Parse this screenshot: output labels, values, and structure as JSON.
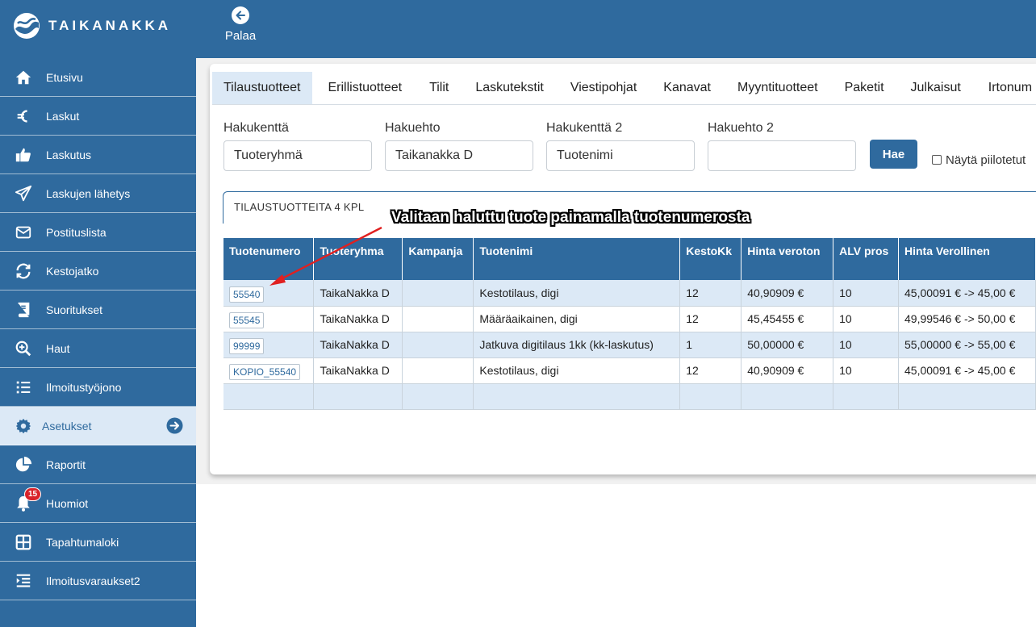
{
  "brand": {
    "name": "TAIKANAKKA",
    "logo_icon": "wave-logo-icon"
  },
  "header": {
    "back_label": "Palaa",
    "back_icon": "arrow-left-circle-icon"
  },
  "sidebar": {
    "items": [
      {
        "label": "Etusivu",
        "icon": "home-icon"
      },
      {
        "label": "Laskut",
        "icon": "euro-icon"
      },
      {
        "label": "Laskutus",
        "icon": "thumbs-up-icon"
      },
      {
        "label": "Laskujen lähetys",
        "icon": "paper-plane-icon"
      },
      {
        "label": "Postituslista",
        "icon": "envelope-icon"
      },
      {
        "label": "Kestojatko",
        "icon": "sync-icon"
      },
      {
        "label": "Suoritukset",
        "icon": "book-icon"
      },
      {
        "label": "Haut",
        "icon": "search-plus-icon"
      },
      {
        "label": "Ilmoitustyöjono",
        "icon": "list-icon"
      },
      {
        "label": "Asetukset",
        "icon": "gear-icon"
      },
      {
        "label": "Raportit",
        "icon": "pie-chart-icon"
      },
      {
        "label": "Huomiot",
        "icon": "bell-icon",
        "badge": "15"
      },
      {
        "label": "Tapahtumaloki",
        "icon": "grid-icon"
      },
      {
        "label": "Ilmoitusvaraukset2",
        "icon": "indent-list-icon"
      }
    ]
  },
  "tabs": [
    "Tilaustuotteet",
    "Erillistuotteet",
    "Tilit",
    "Laskutekstit",
    "Viestipohjat",
    "Kanavat",
    "Myyntituotteet",
    "Paketit",
    "Julkaisut",
    "Irtonum"
  ],
  "search": {
    "field1_label": "Hakukenttä",
    "field1_value": "Tuoteryhmä",
    "cond1_label": "Hakuehto",
    "cond1_value": "Taikanakka D",
    "field2_label": "Hakukenttä 2",
    "field2_value": "Tuotenimi",
    "cond2_label": "Hakuehto 2",
    "cond2_value": "",
    "button_label": "Hae",
    "show_hidden_label": "Näytä piilotetut"
  },
  "section_title": "TILAUSTUOTTEITA 4 KPL",
  "annotation": "Valitaan haluttu tuote painamalla tuotenumerosta",
  "table": {
    "columns": [
      "Tuotenumero",
      "Tuoteryhma",
      "Kampanja",
      "Tuotenimi",
      "KestoKk",
      "Hinta veroton",
      "ALV pros",
      "Hinta Verollinen"
    ],
    "rows": [
      [
        "55540",
        "TaikaNakka D",
        "",
        "Kestotilaus, digi",
        "12",
        "40,90909 €",
        "10",
        "45,00091 € -> 45,00 €"
      ],
      [
        "55545",
        "TaikaNakka D",
        "",
        "Määräaikainen, digi",
        "12",
        "45,45455 €",
        "10",
        "49,99546 € -> 50,00 €"
      ],
      [
        "99999",
        "TaikaNakka D",
        "",
        "Jatkuva digitilaus 1kk (kk-laskutus)",
        "1",
        "50,00000 €",
        "10",
        "55,00000 € -> 55,00 €"
      ],
      [
        "KOPIO_55540",
        "TaikaNakka D",
        "",
        "Kestotilaus, digi",
        "12",
        "40,90909 €",
        "10",
        "45,00091 € -> 45,00 €"
      ],
      [
        "",
        "",
        "",
        "",
        "",
        "",
        "",
        ""
      ]
    ]
  },
  "colors": {
    "brand_blue": "#2f6a9e",
    "active_bg": "#dce9f6",
    "badge_red": "#d9232a",
    "annotation_arrow": "#e02020"
  }
}
